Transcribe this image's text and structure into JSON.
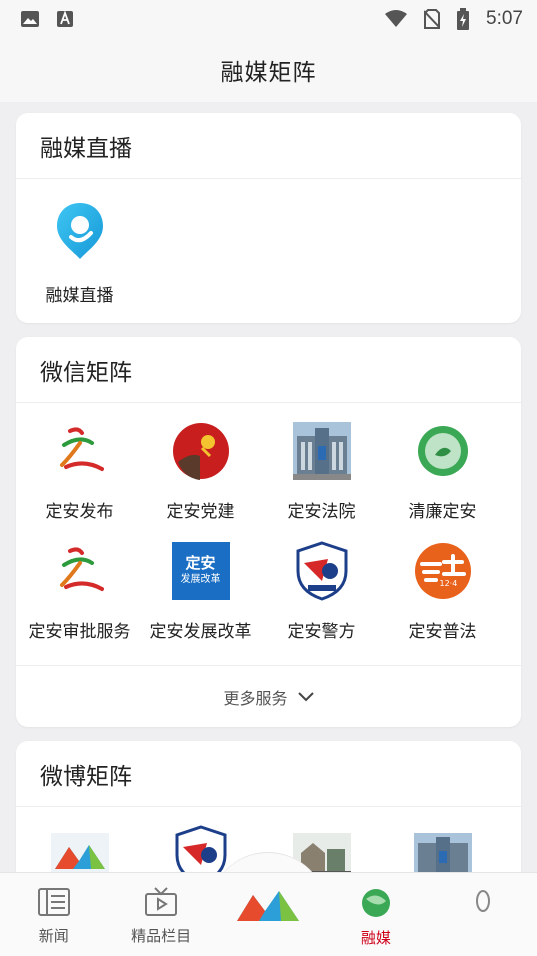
{
  "status_bar": {
    "time": "5:07"
  },
  "header": {
    "title": "融媒矩阵"
  },
  "live_section": {
    "title": "融媒直播",
    "items": [
      {
        "label": "融媒直播",
        "icon": "location-pin-icon"
      }
    ]
  },
  "wechat_section": {
    "title": "微信矩阵",
    "items": [
      {
        "label": "定安发布"
      },
      {
        "label": "定安党建"
      },
      {
        "label": "定安法院"
      },
      {
        "label": "清廉定安"
      },
      {
        "label": "定安审批服务"
      },
      {
        "label": "定安发展改革",
        "logo_text_top": "定安",
        "logo_text_bottom": "发展改革"
      },
      {
        "label": "定安警方"
      },
      {
        "label": "定安普法",
        "logo_text": "12·4"
      }
    ],
    "more_label": "更多服务"
  },
  "weibo_section": {
    "title": "微博矩阵"
  },
  "bottom_nav": {
    "items": [
      {
        "label": "新闻"
      },
      {
        "label": "精品栏目"
      },
      {
        "label": ""
      },
      {
        "label": "融媒"
      },
      {
        "label": ""
      }
    ]
  },
  "colors": {
    "accent": "#d0021b",
    "card": "#ffffff",
    "background": "#efeff1"
  }
}
